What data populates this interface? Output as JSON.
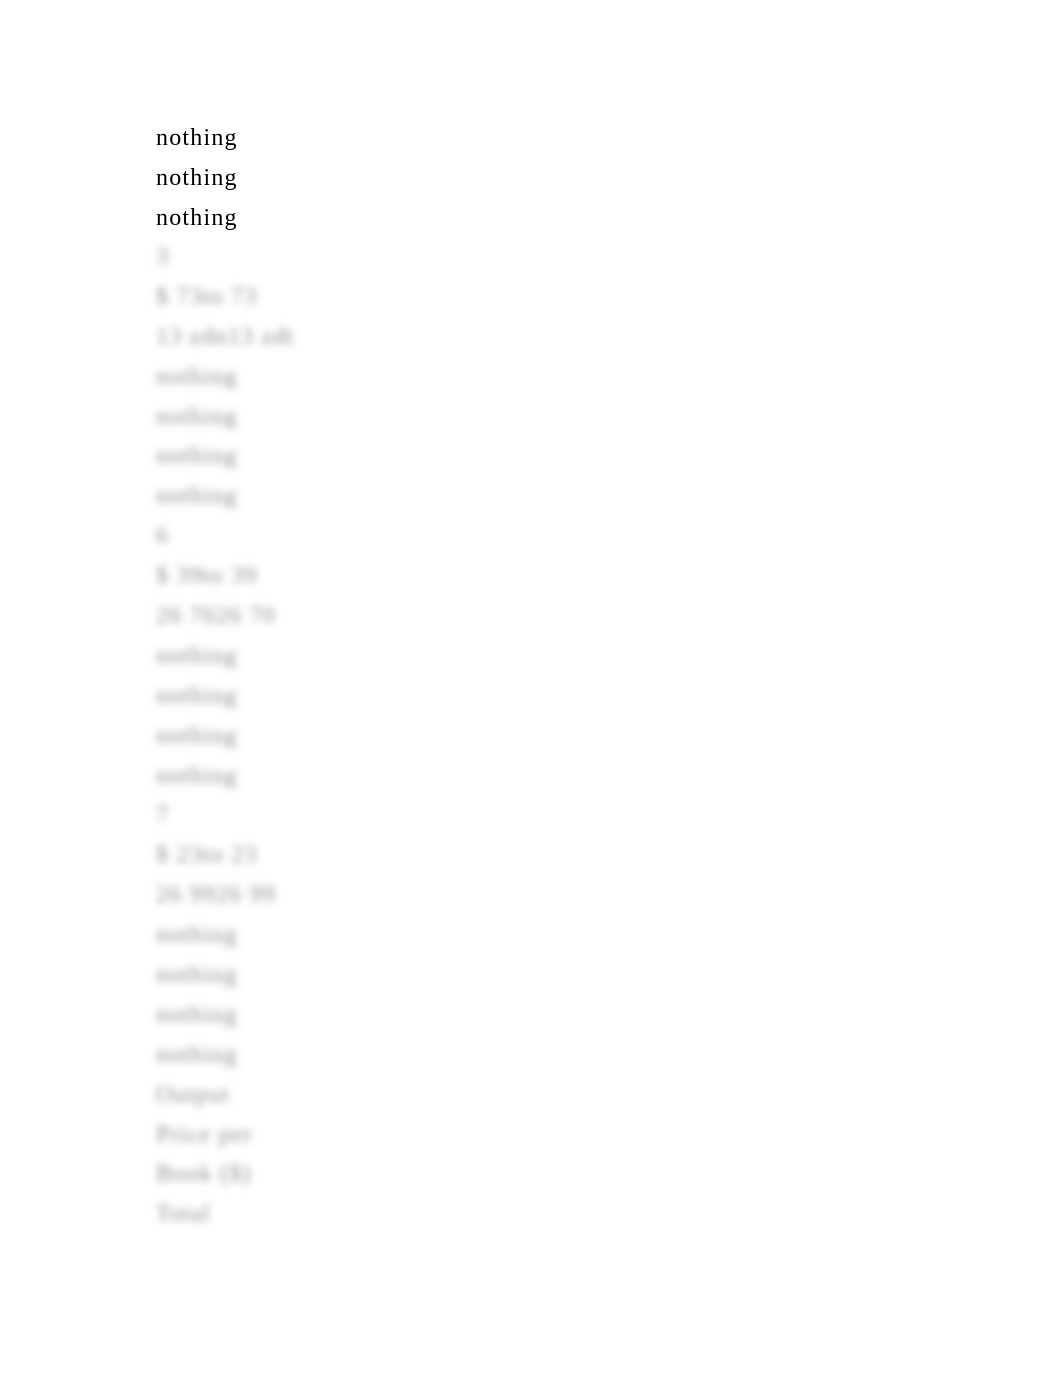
{
  "document": {
    "visible_lines": [
      "nothing",
      "nothing",
      "nothing"
    ],
    "blurred_lines": [
      "3",
      "$ 73to 73",
      "13 zdn13 zdt",
      "nothing",
      "nothing",
      "nothing",
      "nothing",
      "6",
      "$ 39to 39",
      "26 7026 70",
      "nothing",
      "nothing",
      "nothing",
      "nothing",
      "7",
      "$ 23to 23",
      "26 9926 99",
      "nothing",
      "nothing",
      "nothing",
      "nothing",
      "Output",
      "Price per",
      "Book ($)",
      "Total"
    ]
  }
}
